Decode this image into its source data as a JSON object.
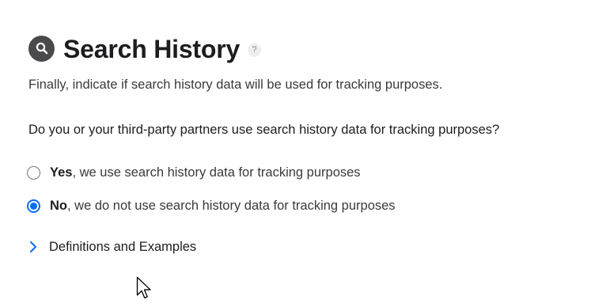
{
  "section": {
    "title": "Search History",
    "help_glyph": "?",
    "icon": "magnifying-glass-icon",
    "intro": "Finally, indicate if search history data will be used for tracking purposes.",
    "question": "Do you or your third-party partners use search history data for tracking purposes?"
  },
  "options": [
    {
      "strong": "Yes",
      "rest": ", we use search history data for tracking purposes",
      "selected": false
    },
    {
      "strong": "No",
      "rest": ", we do not use search history data for tracking purposes",
      "selected": true
    }
  ],
  "disclosure": {
    "label": "Definitions and Examples",
    "icon": "chevron-right-icon",
    "expanded": false
  },
  "colors": {
    "accent": "#0a6cf5",
    "badge": "#4a4a4c",
    "text": "#1d1d1f"
  }
}
